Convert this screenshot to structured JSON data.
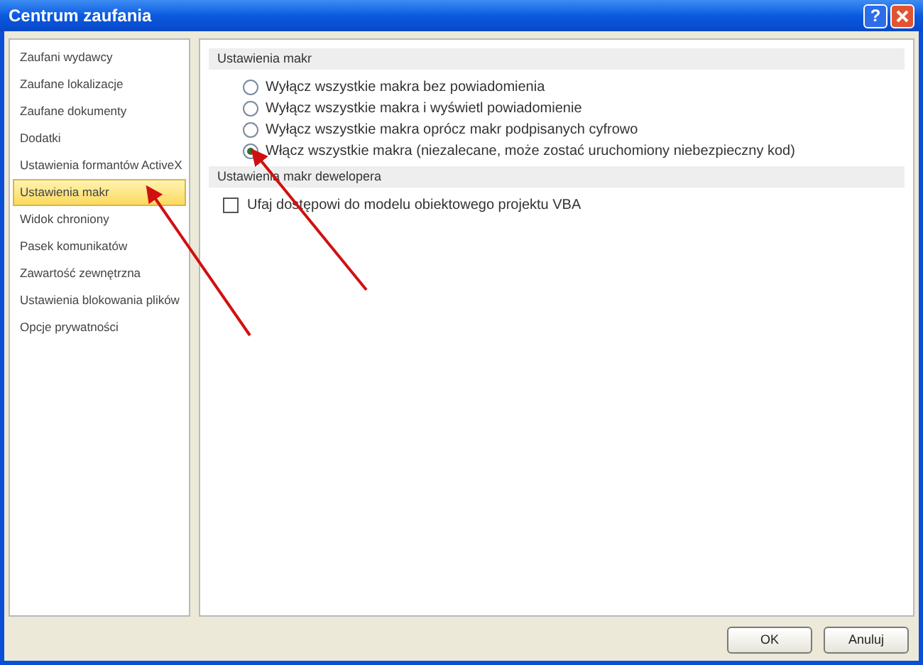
{
  "window": {
    "title": "Centrum zaufania",
    "help_button": "?"
  },
  "sidebar": {
    "items": [
      {
        "label": "Zaufani wydawcy",
        "selected": false
      },
      {
        "label": "Zaufane lokalizacje",
        "selected": false
      },
      {
        "label": "Zaufane dokumenty",
        "selected": false
      },
      {
        "label": "Dodatki",
        "selected": false
      },
      {
        "label": "Ustawienia formantów ActiveX",
        "selected": false
      },
      {
        "label": "Ustawienia makr",
        "selected": true
      },
      {
        "label": "Widok chroniony",
        "selected": false
      },
      {
        "label": "Pasek komunikatów",
        "selected": false
      },
      {
        "label": "Zawartość zewnętrzna",
        "selected": false
      },
      {
        "label": "Ustawienia blokowania plików",
        "selected": false
      },
      {
        "label": "Opcje prywatności",
        "selected": false
      }
    ]
  },
  "sections": [
    {
      "title": "Ustawienia makr",
      "options": [
        {
          "kind": "radio",
          "label": "Wyłącz wszystkie makra bez powiadomienia",
          "selected": false
        },
        {
          "kind": "radio",
          "label": "Wyłącz wszystkie makra i wyświetl powiadomienie",
          "selected": false
        },
        {
          "kind": "radio",
          "label": "Wyłącz wszystkie makra oprócz makr podpisanych cyfrowo",
          "selected": false
        },
        {
          "kind": "radio",
          "label": "Włącz wszystkie makra (niezalecane, może zostać uruchomiony niebezpieczny kod)",
          "selected": true
        }
      ]
    },
    {
      "title": "Ustawienia makr dewelopera",
      "options": [
        {
          "kind": "checkbox",
          "label": "Ufaj dostępowi do modelu obiektowego projektu VBA",
          "checked": false
        }
      ]
    }
  ],
  "buttons": [
    "OK",
    "Anuluj"
  ]
}
